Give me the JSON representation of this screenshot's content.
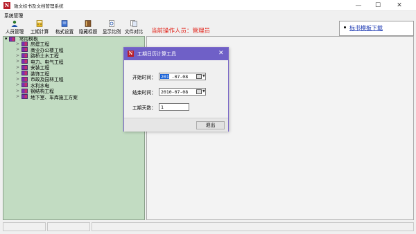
{
  "window": {
    "title": "驰文标书及文档管理系统",
    "app_icon_letter": "N",
    "minimize": "—",
    "maximize": "☐",
    "close": "✕"
  },
  "menu": [
    "系统管理"
  ],
  "toolbar": {
    "buttons": [
      {
        "label": "人员管理",
        "icon": "user-icon"
      },
      {
        "label": "工期计算",
        "icon": "calculator-icon"
      },
      {
        "label": "格式设置",
        "icon": "format-icon"
      },
      {
        "label": "隐藏标题",
        "icon": "book-icon"
      },
      {
        "label": "显示比例",
        "icon": "zoom-icon"
      },
      {
        "label": "文件对比",
        "icon": "compare-icon"
      }
    ],
    "operator_text": "当前操作人员：管理员"
  },
  "link_panel": {
    "link": "标书模板下载"
  },
  "tree": {
    "root_label": "常用模板",
    "items": [
      "房建工程",
      "商业办公楼工程",
      "路桥土木工程",
      "电力、电气工程",
      "安装工程",
      "装饰工程",
      "市政及园林工程",
      "水利水电",
      "钢结构工程",
      "地下室、车库施工方案"
    ]
  },
  "dialog": {
    "title": "工期日历计算工具",
    "close": "✕",
    "start_label": "开始时间：",
    "start_year": "2010",
    "start_rest": "-07-08",
    "end_label": "结束时间：",
    "end_value": "2010-07-08",
    "days_label": "工期天数：",
    "days_value": "1",
    "exit_label": "退出"
  },
  "colors": {
    "tree_bg": "#c2dcc2",
    "dialog_title_bg": "#6f60c7",
    "operator_text": "#e2231a",
    "link": "#1f3bb3"
  }
}
